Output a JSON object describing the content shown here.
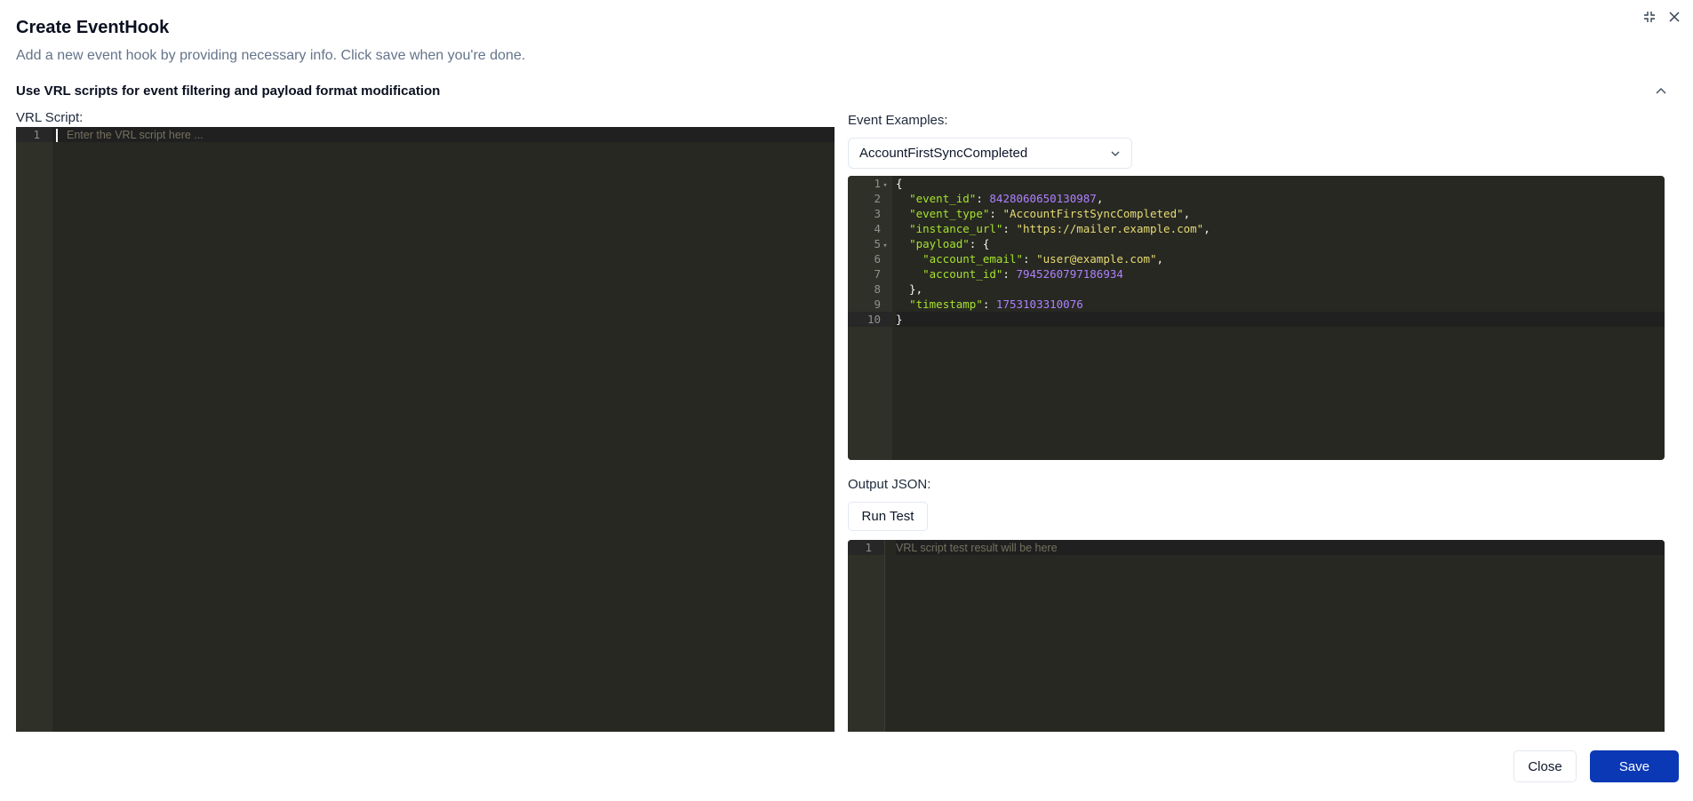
{
  "dialog": {
    "title": "Create EventHook",
    "description": "Add a new event hook by providing necessary info. Click save when you're done."
  },
  "section": {
    "title": "Use VRL scripts for event filtering and payload format modification"
  },
  "vrl": {
    "label": "VRL Script:",
    "placeholder": "Enter the VRL script here ...",
    "line_numbers": [
      "1"
    ]
  },
  "examples": {
    "label": "Event Examples:",
    "selected": "AccountFirstSyncCompleted",
    "line_numbers": [
      "1",
      "2",
      "3",
      "4",
      "5",
      "6",
      "7",
      "8",
      "9",
      "10"
    ],
    "json": {
      "event_id_key": "\"event_id\"",
      "event_id_val": "8428060650130987",
      "event_type_key": "\"event_type\"",
      "event_type_val": "\"AccountFirstSyncCompleted\"",
      "instance_url_key": "\"instance_url\"",
      "instance_url_val": "\"https://mailer.example.com\"",
      "payload_key": "\"payload\"",
      "account_email_key": "\"account_email\"",
      "account_email_val": "\"user@example.com\"",
      "account_id_key": "\"account_id\"",
      "account_id_val": "7945260797186934",
      "timestamp_key": "\"timestamp\"",
      "timestamp_val": "1753103310076"
    }
  },
  "output": {
    "label": "Output JSON:",
    "run_label": "Run Test",
    "placeholder": "VRL script test result will be here",
    "line_numbers": [
      "1"
    ]
  },
  "footer": {
    "close_label": "Close",
    "save_label": "Save"
  },
  "colors": {
    "primary": "#0b38b5",
    "editor_bg": "#272822",
    "json_key": "#a6e22e",
    "json_string": "#e6db74",
    "json_number": "#ae81ff"
  }
}
